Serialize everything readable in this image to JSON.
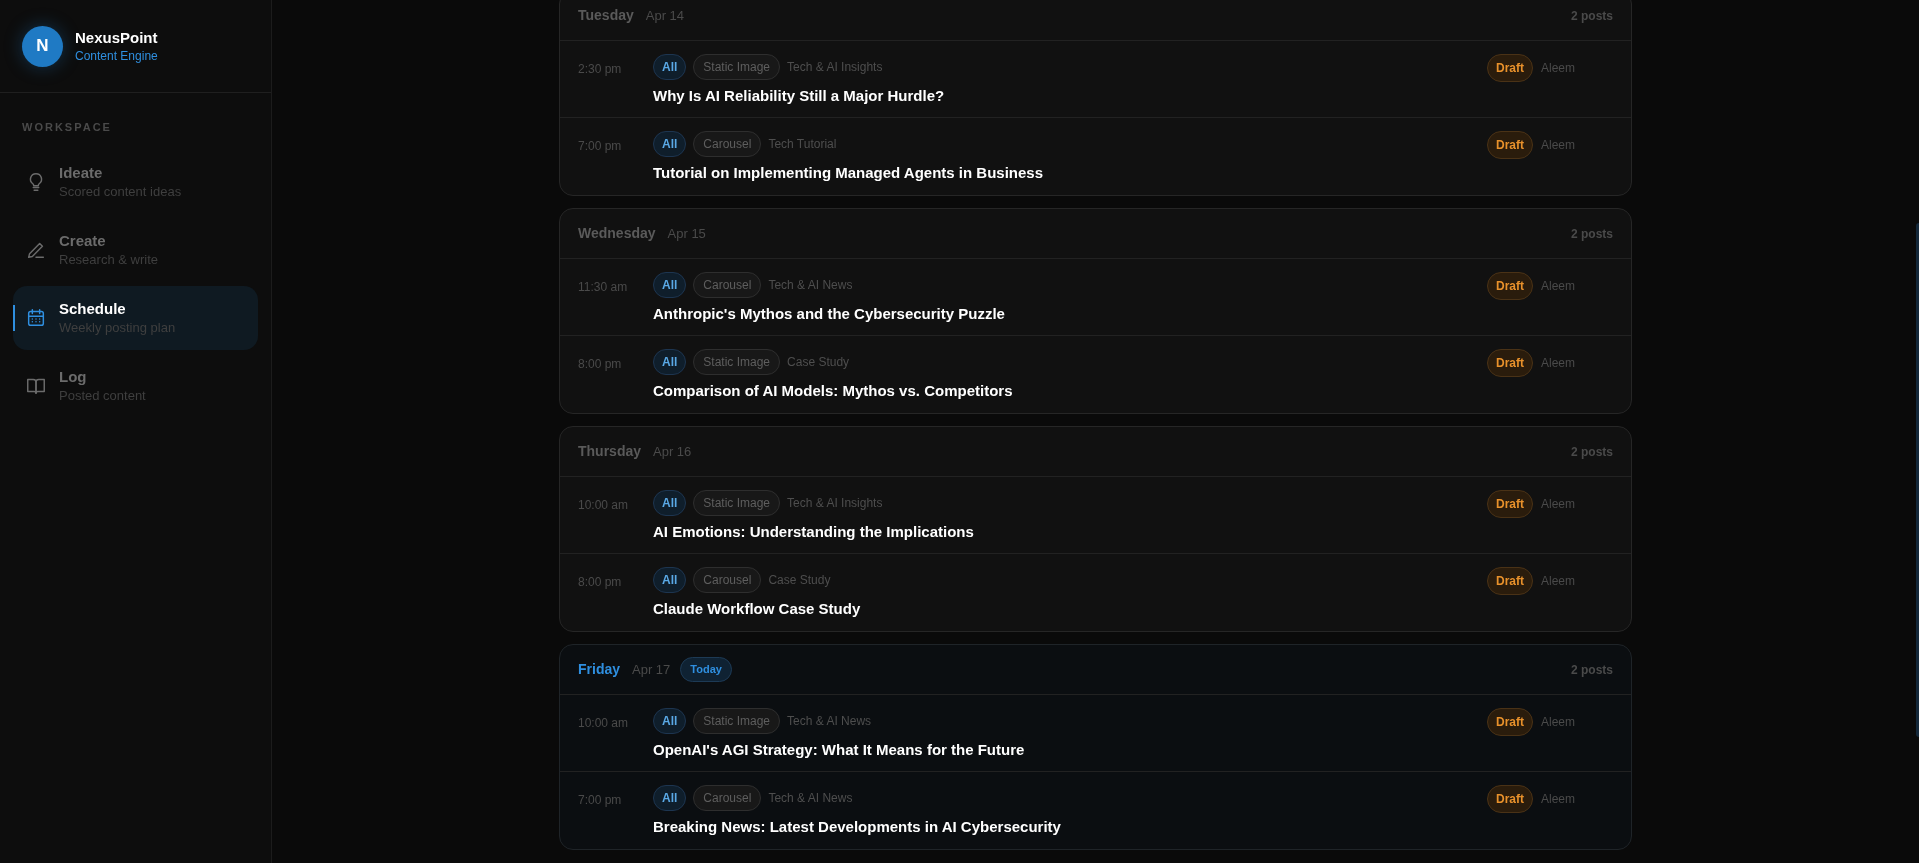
{
  "brand": {
    "initial": "N",
    "name": "NexusPoint",
    "subtitle": "Content Engine"
  },
  "sidebar": {
    "section_label": "WORKSPACE",
    "items": [
      {
        "label": "Ideate",
        "description": "Scored content ideas",
        "selected": false
      },
      {
        "label": "Create",
        "description": "Research & write",
        "selected": false
      },
      {
        "label": "Schedule",
        "description": "Weekly posting plan",
        "selected": true
      },
      {
        "label": "Log",
        "description": "Posted content",
        "selected": false
      }
    ]
  },
  "days": [
    {
      "day": "Tuesday",
      "date": "Apr 14",
      "today": false,
      "count": "2 posts",
      "posts": [
        {
          "time": "2:30 pm",
          "audience": "All",
          "format": "Static Image",
          "category": "Tech & AI Insights",
          "title": "Why Is AI Reliability Still a Major Hurdle?",
          "status": "Draft",
          "author": "Aleem"
        },
        {
          "time": "7:00 pm",
          "audience": "All",
          "format": "Carousel",
          "category": "Tech Tutorial",
          "title": "Tutorial on Implementing Managed Agents in Business",
          "status": "Draft",
          "author": "Aleem"
        }
      ]
    },
    {
      "day": "Wednesday",
      "date": "Apr 15",
      "today": false,
      "count": "2 posts",
      "posts": [
        {
          "time": "11:30 am",
          "audience": "All",
          "format": "Carousel",
          "category": "Tech & AI News",
          "title": "Anthropic's Mythos and the Cybersecurity Puzzle",
          "status": "Draft",
          "author": "Aleem"
        },
        {
          "time": "8:00 pm",
          "audience": "All",
          "format": "Static Image",
          "category": "Case Study",
          "title": "Comparison of AI Models: Mythos vs. Competitors",
          "status": "Draft",
          "author": "Aleem"
        }
      ]
    },
    {
      "day": "Thursday",
      "date": "Apr 16",
      "today": false,
      "count": "2 posts",
      "posts": [
        {
          "time": "10:00 am",
          "audience": "All",
          "format": "Static Image",
          "category": "Tech & AI Insights",
          "title": "AI Emotions: Understanding the Implications",
          "status": "Draft",
          "author": "Aleem"
        },
        {
          "time": "8:00 pm",
          "audience": "All",
          "format": "Carousel",
          "category": "Case Study",
          "title": "Claude Workflow Case Study",
          "status": "Draft",
          "author": "Aleem"
        }
      ]
    },
    {
      "day": "Friday",
      "date": "Apr 17",
      "today": true,
      "today_badge": "Today",
      "count": "2 posts",
      "posts": [
        {
          "time": "10:00 am",
          "audience": "All",
          "format": "Static Image",
          "category": "Tech & AI News",
          "title": "OpenAI's AGI Strategy: What It Means for the Future",
          "status": "Draft",
          "author": "Aleem"
        },
        {
          "time": "7:00 pm",
          "audience": "All",
          "format": "Carousel",
          "category": "Tech & AI News",
          "title": "Breaking News: Latest Developments in AI Cybersecurity",
          "status": "Draft",
          "author": "Aleem"
        }
      ]
    }
  ]
}
